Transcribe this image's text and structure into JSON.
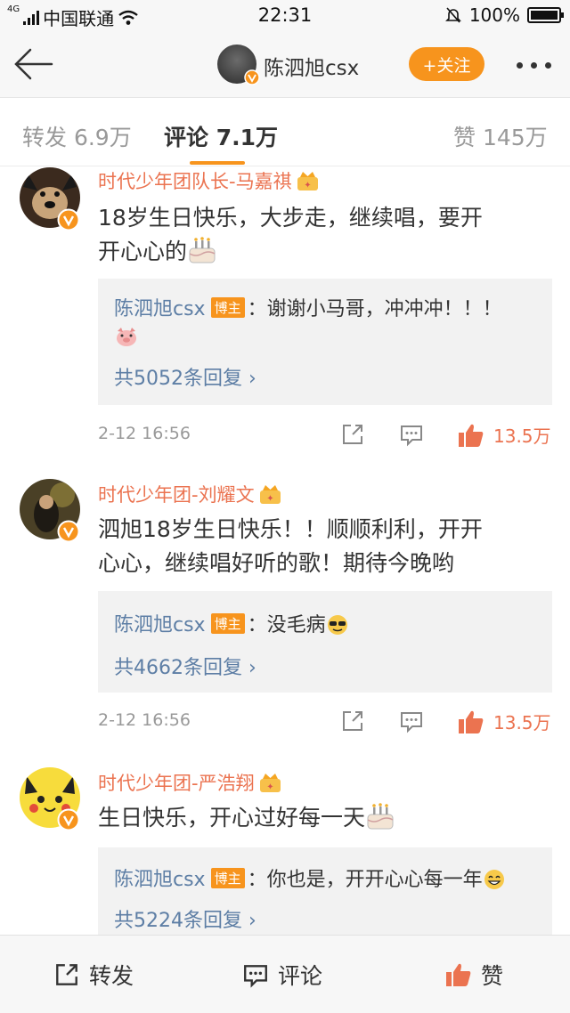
{
  "status_bar": {
    "carrier": "中国联通",
    "network": "4G",
    "time": "22:31",
    "battery": "100%"
  },
  "header": {
    "username": "陈泗旭csx",
    "follow_label": "+关注"
  },
  "tabs": [
    {
      "label": "转发 6.9万"
    },
    {
      "label": "评论 7.1万"
    },
    {
      "label": "赞 145万"
    }
  ],
  "comments": [
    {
      "author": "时代少年团队长-马嘉祺",
      "text_line1": "18岁生日快乐，大步走，继续唱，要开",
      "text_line2": "开心心的",
      "reply": {
        "author": "陈泗旭csx",
        "tag": "博主",
        "text": "：谢谢小马哥，冲冲冲！！！",
        "count": "共5052条回复"
      },
      "time": "2-12 16:56",
      "likes": "13.5万"
    },
    {
      "author": "时代少年团-刘耀文",
      "text_line1": "泗旭18岁生日快乐！！顺顺利利，开开",
      "text_line2": "心心，继续唱好听的歌！期待今晚哟",
      "reply": {
        "author": "陈泗旭csx",
        "tag": "博主",
        "text": "：没毛病",
        "count": "共4662条回复"
      },
      "time": "2-12 16:56",
      "likes": "13.5万"
    },
    {
      "author": "时代少年团-严浩翔",
      "text_line1": "生日快乐，开心过好每一天",
      "reply": {
        "author": "陈泗旭csx",
        "tag": "博主",
        "text": "：你也是，开开心心每一年",
        "count": "共5224条回复"
      }
    }
  ],
  "bottom_bar": {
    "repost_label": "转发",
    "comment_label": "评论",
    "like_label": "赞"
  },
  "colors": {
    "accent": "#f7941d",
    "name": "#eb7350",
    "link": "#5d7ea5"
  }
}
